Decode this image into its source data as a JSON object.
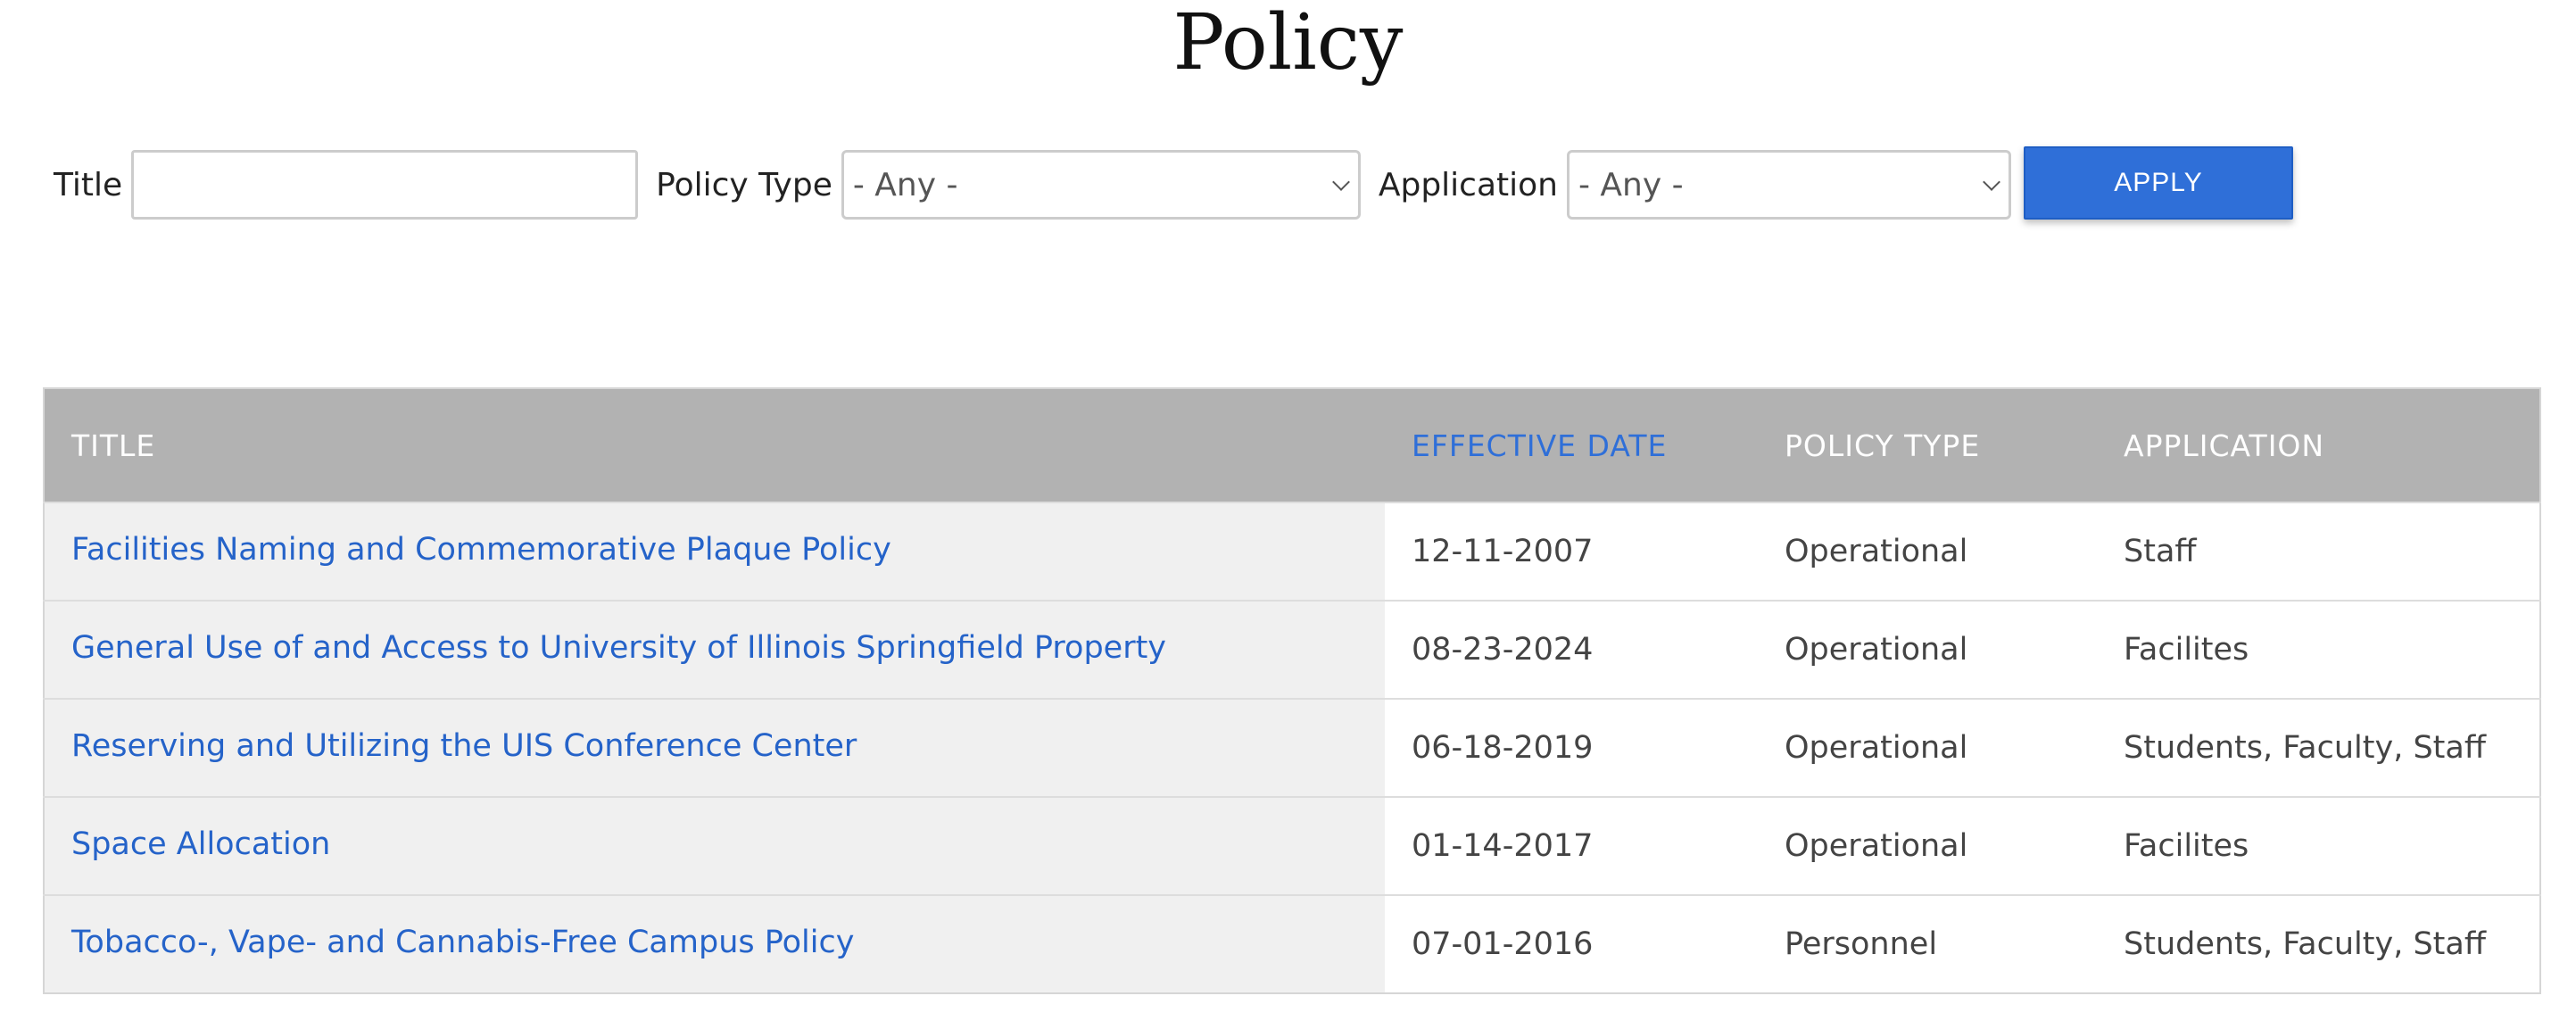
{
  "page": {
    "title": "Policy"
  },
  "filters": {
    "title_label": "Title",
    "title_value": "",
    "policy_type_label": "Policy Type",
    "policy_type_selected": "- Any -",
    "application_label": "Application",
    "application_selected": "- Any -",
    "apply_label": "APPLY"
  },
  "table": {
    "headers": {
      "title": "TITLE",
      "effective_date": "EFFECTIVE DATE",
      "policy_type": "POLICY TYPE",
      "application": "APPLICATION"
    },
    "rows": [
      {
        "title": "Facilities Naming and Commemorative Plaque Policy",
        "effective_date": "12-11-2007",
        "policy_type": "Operational",
        "application": "Staff"
      },
      {
        "title": "General Use of and Access to University of Illinois Springfield Property",
        "effective_date": "08-23-2024",
        "policy_type": "Operational",
        "application": "Facilites"
      },
      {
        "title": "Reserving and Utilizing the UIS Conference Center",
        "effective_date": "06-18-2019",
        "policy_type": "Operational",
        "application": "Students, Faculty, Staff"
      },
      {
        "title": "Space Allocation",
        "effective_date": "01-14-2017",
        "policy_type": "Operational",
        "application": "Facilites"
      },
      {
        "title": "Tobacco-, Vape- and Cannabis-Free Campus Policy",
        "effective_date": "07-01-2016",
        "policy_type": "Personnel",
        "application": "Students, Faculty, Staff"
      }
    ]
  },
  "colors": {
    "accent": "#2f6fd8",
    "link": "#2563c9",
    "header_bg": "#b2b2b2",
    "title_cell_bg": "#f0f0f0"
  },
  "icons": {
    "select_arrow": "chevron-down-icon"
  }
}
